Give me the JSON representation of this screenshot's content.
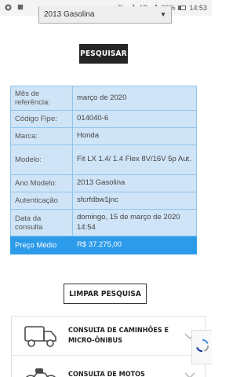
{
  "status_bar": {
    "signal_text": "4G",
    "battery": "29%",
    "time": "14:53"
  },
  "form": {
    "selected_option": "2013 Gasolina",
    "search_button": "PESQUISAR",
    "clear_button": "LIMPAR PESQUISA"
  },
  "results": [
    {
      "label": "Mês de referência:",
      "value": "março de 2020"
    },
    {
      "label": "Código Fipe:",
      "value": "014040-6"
    },
    {
      "label": "Marca:",
      "value": "Honda"
    },
    {
      "label": "Modelo:",
      "value": "Fit LX 1.4/ 1.4 Flex 8V/16V 5p Aut."
    },
    {
      "label": "Ano Modelo:",
      "value": "2013 Gasolina"
    },
    {
      "label": "Autenticação",
      "value": "sfcrfdbw1jnc"
    },
    {
      "label": "Data da consulta",
      "value": "domingo, 15 de março de 2020 14:54"
    },
    {
      "label": "Preço Médio",
      "value": "R$ 37.275,00"
    }
  ],
  "accordion": [
    {
      "label": "CONSULTA DE CAMINHÕES E MICRO-ÔNIBUS",
      "icon": "truck-icon"
    },
    {
      "label": "CONSULTA DE MOTOS",
      "icon": "motorcycle-icon"
    }
  ],
  "colors": {
    "table_bg": "#cfe4f6",
    "table_border": "#90c4ec",
    "price_bg": "#2c9bea",
    "button_dark": "#252525"
  }
}
